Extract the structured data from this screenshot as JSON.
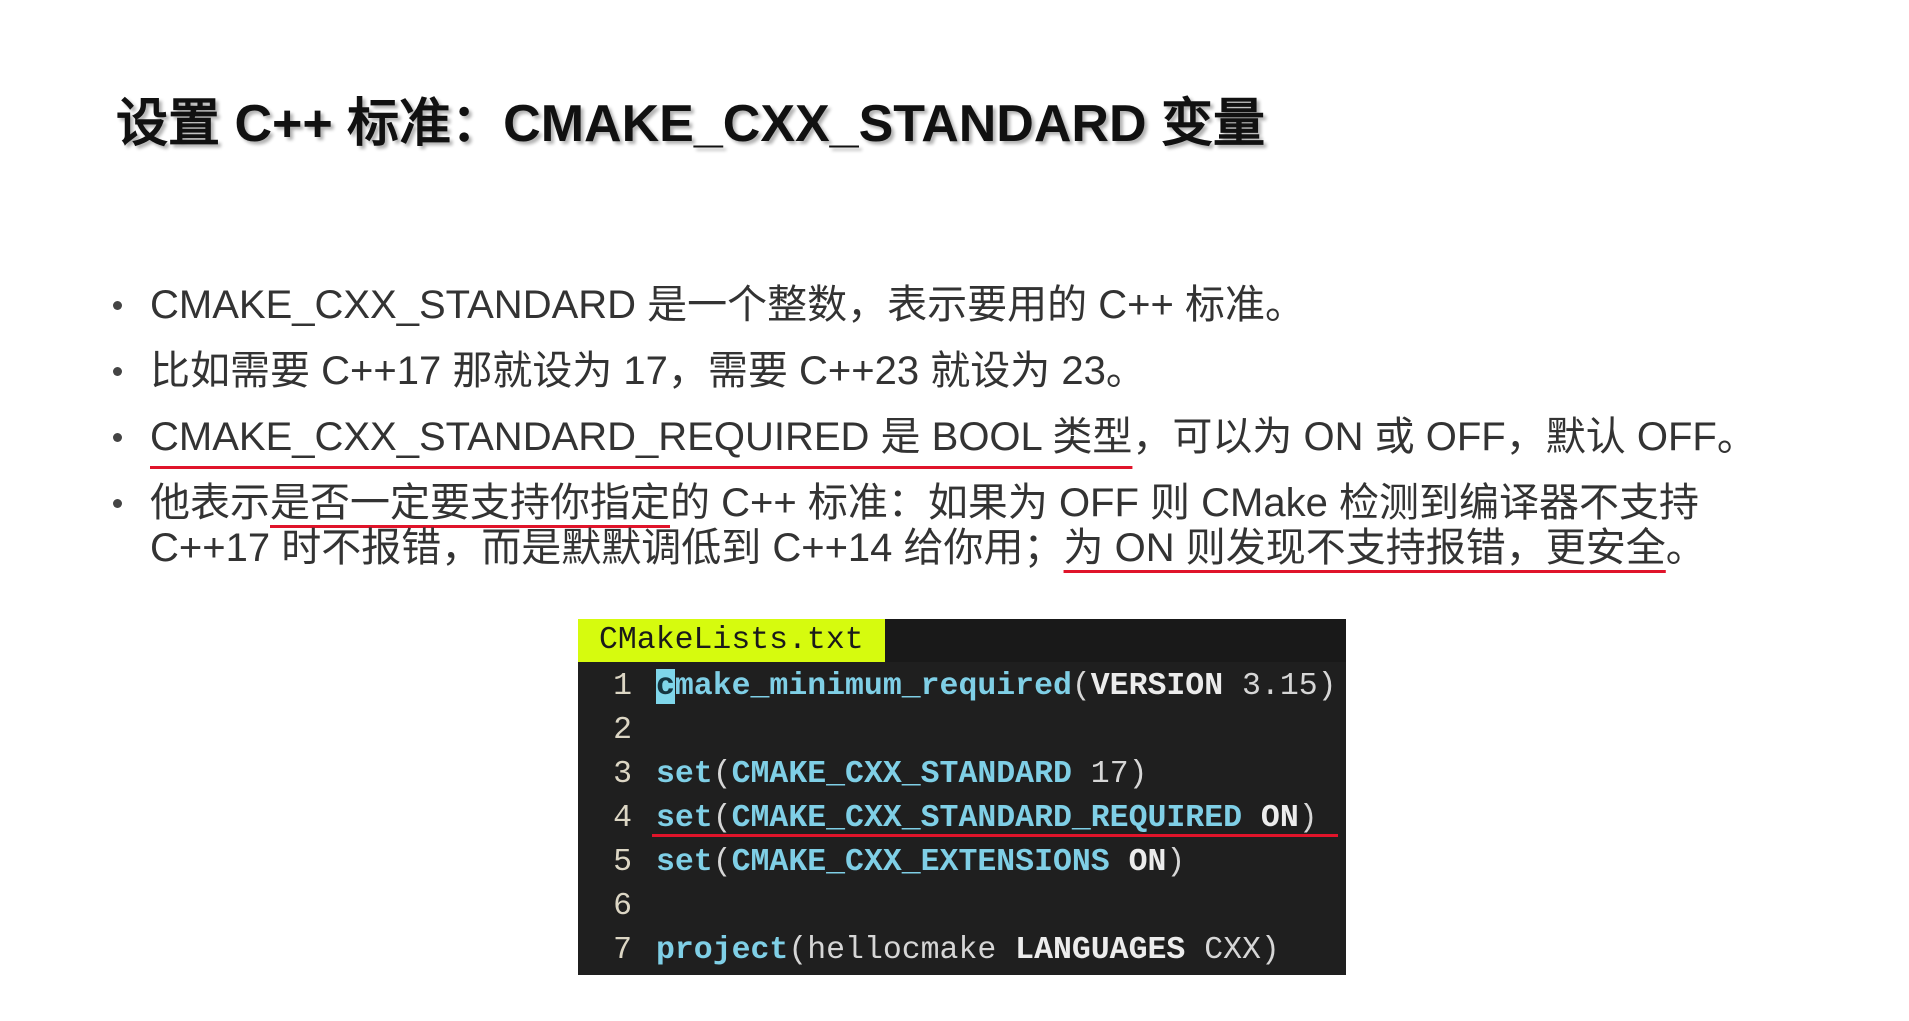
{
  "slide": {
    "title": "设置 C++ 标准：CMAKE_CXX_STANDARD 变量",
    "bullets": [
      {
        "segments": [
          {
            "text": "CMAKE_CXX_STANDARD 是一个整数，表示要用的 C++ 标准。"
          }
        ]
      },
      {
        "segments": [
          {
            "text": "比如需要 C++17 那就设为 17，需要 C++23 就设为 23。"
          }
        ]
      },
      {
        "segments": [
          {
            "text": "CMAKE_CXX_STANDARD_REQUIRED 是 BOOL 类型",
            "underline": true
          },
          {
            "text": "，可以为 ON 或 OFF，默认 OFF。"
          }
        ]
      },
      {
        "lines": [
          {
            "segments": [
              {
                "text": "他表示"
              },
              {
                "text": "是否一定要支持你指定",
                "underline": true
              },
              {
                "text": "的 C++ 标准：如果为 OFF 则 CMake 检测到编译器不支持"
              }
            ]
          },
          {
            "segments": [
              {
                "text": "C++17 时不报错，而是默默调低到 C++14 给你用；"
              },
              {
                "text": "为 ON 则发现不支持报错，更安全",
                "underline": true
              },
              {
                "text": "。"
              }
            ]
          }
        ]
      }
    ]
  },
  "code_editor": {
    "tab_label": "CMakeLists.txt",
    "lines": [
      {
        "number": "1",
        "tokens": [
          "c",
          "make_minimum_required",
          "(",
          "VERSION",
          " 3.15",
          ")"
        ]
      },
      {
        "number": "2",
        "tokens": []
      },
      {
        "number": "3",
        "tokens": [
          "set",
          "(",
          "CMAKE_CXX_STANDARD",
          " 17",
          ")"
        ]
      },
      {
        "number": "4",
        "tokens": [
          "set",
          "(",
          "CMAKE_CXX_STANDARD_REQUIRED",
          " ON",
          ")"
        ],
        "underline": true
      },
      {
        "number": "5",
        "tokens": [
          "set",
          "(",
          "CMAKE_CXX_EXTENSIONS",
          " ON",
          ")"
        ]
      },
      {
        "number": "6",
        "tokens": []
      },
      {
        "number": "7",
        "tokens": [
          "project",
          "(",
          "hellocmake",
          " LANGUAGES",
          " CXX",
          ")"
        ]
      }
    ]
  },
  "colors": {
    "annotation_red": "#e0142a",
    "editor_background": "#1f1f1f",
    "tab_background": "#d6fb0e",
    "syntax_keyword": "#7fcfe6",
    "cursor": "#7fd6ea",
    "line_number": "#dcd6c4"
  }
}
